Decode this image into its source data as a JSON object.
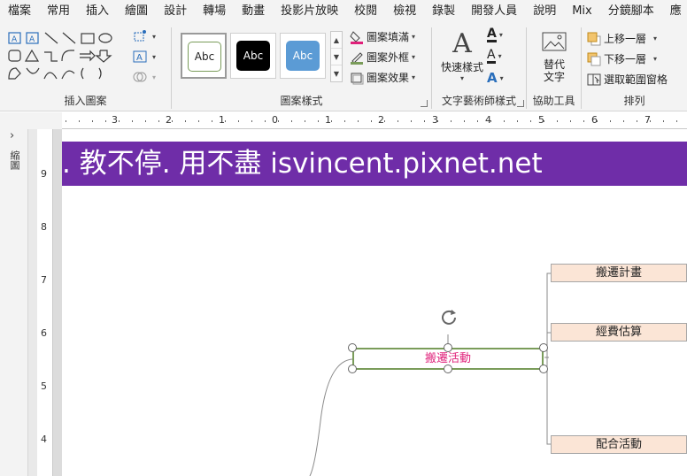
{
  "menu": {
    "tabs": [
      "檔案",
      "常用",
      "插入",
      "繪圖",
      "設計",
      "轉場",
      "動畫",
      "投影片放映",
      "校閱",
      "檢視",
      "錄製",
      "開發人員",
      "說明",
      "Mix",
      "分鏡腳本",
      "應"
    ]
  },
  "ribbon": {
    "insert_shapes": {
      "label": "插入圖案"
    },
    "shape_styles": {
      "label": "圖案樣式",
      "presets": [
        "Abc",
        "Abc",
        "Abc"
      ],
      "fill": "圖案填滿",
      "outline": "圖案外框",
      "effects": "圖案效果"
    },
    "wordart": {
      "label": "文字藝術師樣式",
      "quick_styles": "快速樣式"
    },
    "accessibility": {
      "label": "協助工具",
      "alt_text": "替代\n文字"
    },
    "arrange": {
      "label": "排列",
      "bring_forward": "上移一層",
      "send_backward": "下移一層",
      "selection_pane": "選取範圍窗格"
    }
  },
  "side_panel": {
    "label": "縮圖"
  },
  "ruler": {
    "h_numbers": [
      "3",
      "2",
      "1",
      "0",
      "1",
      "2",
      "3",
      "4",
      "5",
      "6",
      "7"
    ],
    "v_numbers": [
      "9",
      "8",
      "7",
      "6",
      "5",
      "4"
    ]
  },
  "slide": {
    "banner_text": ". 教不停. 用不盡 isvincent.pixnet.net",
    "center_node": "搬遷活動",
    "nodes": [
      "搬遷計畫",
      "經費估算",
      "配合活動"
    ]
  },
  "colors": {
    "banner": "#6f2da8",
    "node_fill": "#fbe5d6",
    "center_text": "#e0207a",
    "center_border": "#7a9c5a"
  }
}
